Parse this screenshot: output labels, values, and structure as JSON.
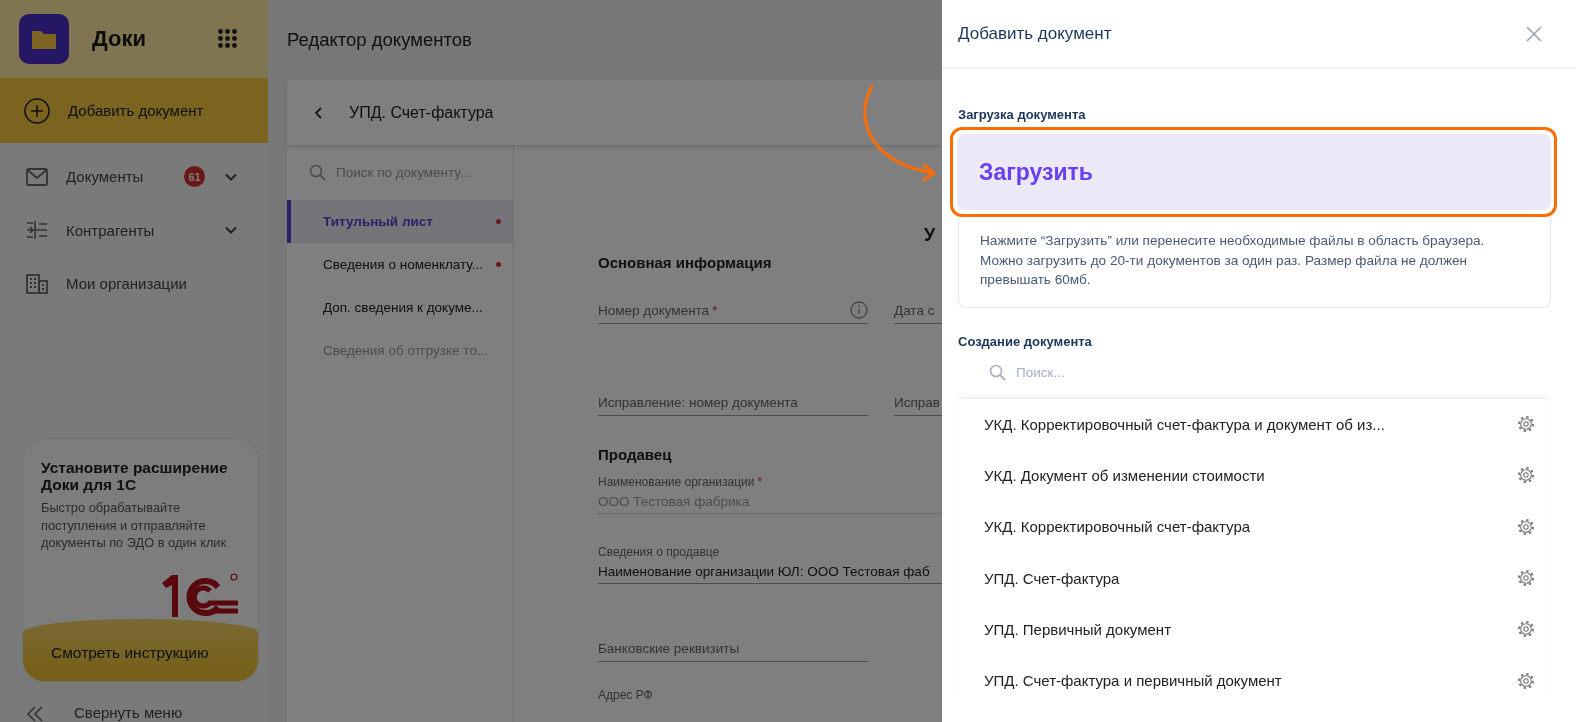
{
  "sidebar": {
    "app_name": "Доки",
    "add_button": "Добавить документ",
    "nav": [
      {
        "label": "Документы",
        "badge": "61",
        "expandable": true
      },
      {
        "label": "Контрагенты",
        "expandable": true
      },
      {
        "label": "Мои организации",
        "expandable": false
      }
    ],
    "promo": {
      "title": "Установите расширение Доки для 1С",
      "text": "Быстро обрабатывайте поступления и отправляйте документы по ЭДО в один клик",
      "button": "Смотреть инструкцию"
    },
    "collapse": "Свернуть меню"
  },
  "page": {
    "title": "Редактор документов"
  },
  "editor": {
    "document_title": "УПД. Счет-фактура",
    "search": {
      "placeholder": "Поиск по документу..."
    },
    "sections": [
      {
        "label": "Титульный лист",
        "selected": true,
        "has_errors": true,
        "disabled": false
      },
      {
        "label": "Сведения о номенклату...",
        "selected": false,
        "has_errors": true,
        "disabled": false
      },
      {
        "label": "Доп. сведения к докуме...",
        "selected": false,
        "has_errors": false,
        "disabled": false
      },
      {
        "label": "Сведения об отгрузке то...",
        "selected": false,
        "has_errors": false,
        "disabled": true
      }
    ],
    "heading": "У",
    "form": [
      {
        "kind": "heading",
        "text": "Основная информация"
      },
      {
        "kind": "row",
        "fields": [
          {
            "label": "Номер документа",
            "required_mark": "*",
            "info": true
          },
          {
            "label": "Дата с"
          }
        ]
      },
      {
        "kind": "row",
        "fields": [
          {
            "label": "Исправление: номер документа"
          },
          {
            "label": "Исправ"
          }
        ]
      },
      {
        "kind": "heading",
        "text": "Продавец"
      },
      {
        "kind": "labeled",
        "label": "Наименование организации",
        "required_mark": "*",
        "value": "ООО Тестовая фабрика",
        "disabled": true
      },
      {
        "kind": "labeled",
        "label": "Сведения о продавце",
        "value": "Наименование организации ЮЛ: ООО Тестовая фаб"
      },
      {
        "kind": "row",
        "fields": [
          {
            "label": "Банковские реквизиты"
          }
        ]
      },
      {
        "kind": "labeled",
        "label": "Адрес РФ"
      }
    ]
  },
  "drawer": {
    "title": "Добавить документ",
    "upload": {
      "label": "Загрузка документа",
      "button": "Загрузить",
      "highlighted": true,
      "hint": "Нажмите “Загрузить” или перенесите необходимые файлы в область браузера. Можно загрузить до 20-ти документов за один раз. Размер файла не должен превышать 60мб."
    },
    "create": {
      "label": "Создание документа",
      "search": {
        "placeholder": "Поиск..."
      },
      "items": [
        {
          "label": "УКД. Корректировочный счет-фактура и документ об из..."
        },
        {
          "label": "УКД. Документ об изменении стоимости"
        },
        {
          "label": "УКД. Корректировочный счет-фактура"
        },
        {
          "label": "УПД. Счет-фактура"
        },
        {
          "label": "УПД. Первичный документ"
        },
        {
          "label": "УПД. Счет-фактура и первичный документ"
        }
      ]
    }
  }
}
